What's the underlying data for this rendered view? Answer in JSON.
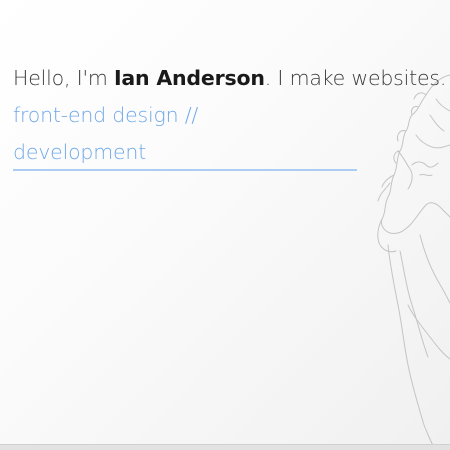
{
  "intro": {
    "prefix": "Hello, I'm ",
    "name": "Ian Anderson",
    "suffix": ". I make websites."
  },
  "tagline": {
    "line1": "front-end design //",
    "line2": "development"
  },
  "colors": {
    "accent": "#6fa8e8",
    "accent_rule": "#a9cdf4",
    "text": "#3a3a3a",
    "sketch": "#c4c4c4"
  },
  "illustration": {
    "icon": "portrait-sketch-icon"
  }
}
